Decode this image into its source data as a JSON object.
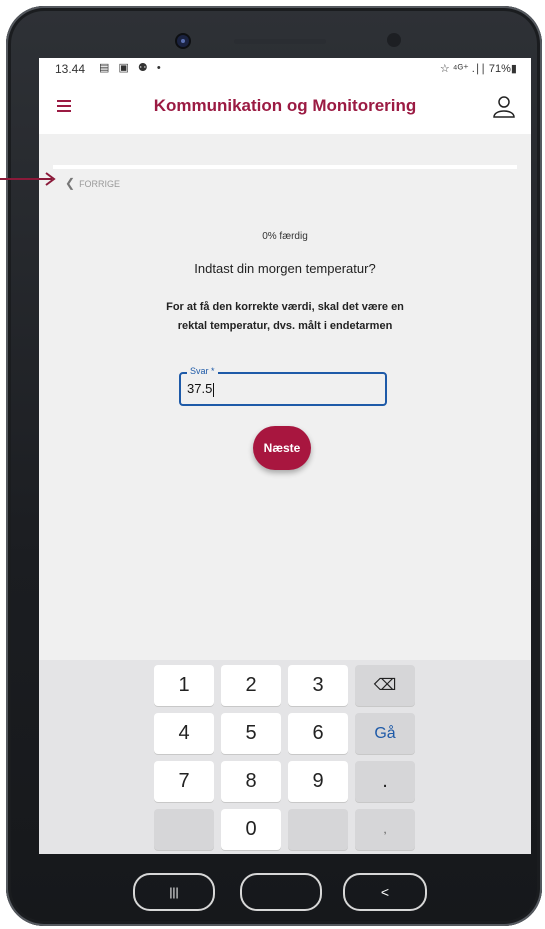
{
  "status_bar": {
    "time": "13.44",
    "left_icons": "▤ ▣ ⚉ •",
    "right": "☆ ⁴ᴳ⁺ .∣∣ 71%▮"
  },
  "app_bar": {
    "title": "Kommunikation og Monitorering"
  },
  "nav": {
    "back_label": "FORRIGE"
  },
  "progress": {
    "fraction": 0.0,
    "text": "0% færdig"
  },
  "question": {
    "title": "Indtast din morgen temperatur?",
    "hint": "For at få den korrekte værdi, skal det være en rektal temperatur, dvs. målt i endetarmen"
  },
  "answer": {
    "label": "Svar *",
    "value": "37.5"
  },
  "next_button": {
    "label": "Næste"
  },
  "keyboard": {
    "rows": [
      [
        "1",
        "2",
        "3",
        "⌫"
      ],
      [
        "4",
        "5",
        "6",
        "Gå"
      ],
      [
        "7",
        "8",
        "9",
        "."
      ],
      [
        "",
        "0",
        "",
        ","
      ]
    ]
  },
  "system_nav": {
    "recents": "|||",
    "home": "",
    "back": "<"
  },
  "colors": {
    "accent": "#9b1b43",
    "field_focus": "#1e5aa8"
  }
}
